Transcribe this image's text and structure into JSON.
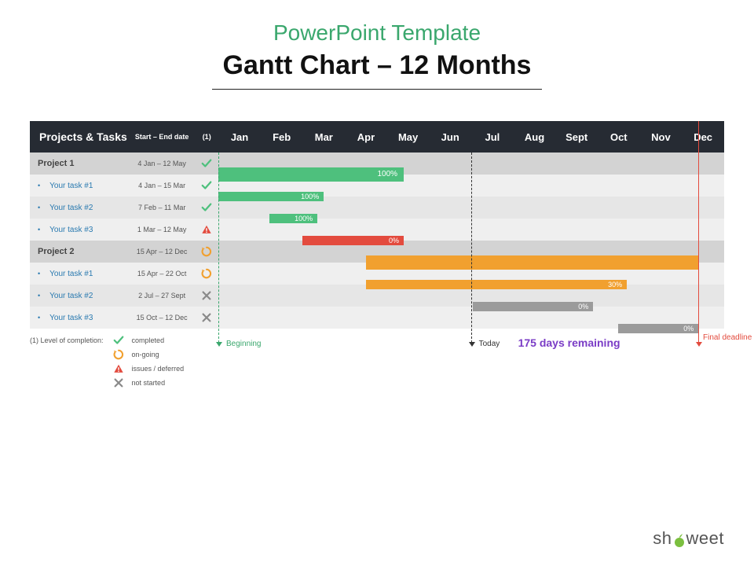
{
  "header": {
    "subtitle": "PowerPoint Template",
    "title": "Gantt Chart – 12 Months"
  },
  "columns": {
    "name": "Projects & Tasks",
    "dates": "Start – End date",
    "status": "(1)"
  },
  "months": [
    "Jan",
    "Feb",
    "Mar",
    "Apr",
    "May",
    "Jun",
    "Jul",
    "Aug",
    "Sept",
    "Oct",
    "Nov",
    "Dec"
  ],
  "rows": [
    {
      "kind": "proj",
      "name": "Project 1",
      "dates": "4 Jan – 12  May",
      "status": "check"
    },
    {
      "kind": "task",
      "name": "Your task #1",
      "dates": "4 Jan – 15 Mar",
      "status": "check"
    },
    {
      "kind": "task",
      "name": "Your task #2",
      "dates": "7 Feb – 11 Mar",
      "status": "check",
      "alt": true
    },
    {
      "kind": "task",
      "name": "Your task #3",
      "dates": "1 Mar – 12 May",
      "status": "warn"
    },
    {
      "kind": "proj",
      "name": "Project 2",
      "dates": "15 Apr – 12 Dec",
      "status": "cycle"
    },
    {
      "kind": "task",
      "name": "Your task #1",
      "dates": "15 Apr – 22 Oct",
      "status": "cycle"
    },
    {
      "kind": "task",
      "name": "Your task #2",
      "dates": "2 Jul – 27 Sept",
      "status": "cross",
      "alt": true
    },
    {
      "kind": "task",
      "name": "Your task #3",
      "dates": "15 Oct – 12 Dec",
      "status": "cross"
    }
  ],
  "status_labels": {
    "check": "completed",
    "cycle": "on-going",
    "warn": "issues / deferred",
    "cross": "not started"
  },
  "legend_head": "(1) Level of completion:",
  "markers": {
    "beginning_label": "Beginning",
    "today_label": "Today",
    "final_label": "Final deadline",
    "remaining": "175 days remaining"
  },
  "brand": {
    "pre": "sh",
    "post": "weet"
  },
  "chart_data": {
    "type": "gantt",
    "title": "Gantt Chart – 12 Months",
    "x_categories": [
      "Jan",
      "Feb",
      "Mar",
      "Apr",
      "May",
      "Jun",
      "Jul",
      "Aug",
      "Sept",
      "Oct",
      "Nov",
      "Dec"
    ],
    "markers": {
      "beginning_month_index": 0,
      "today_month_index": 6.0,
      "final_deadline_month_index": 11.4
    },
    "days_remaining": 175,
    "rows": [
      {
        "row": 0,
        "type": "project",
        "name": "Project 1",
        "start": "4 Jan",
        "end": "12 May",
        "start_idx": 0.0,
        "end_idx": 4.4,
        "completion_pct": 100,
        "status": "completed",
        "color": "green"
      },
      {
        "row": 1,
        "type": "task",
        "name": "Your task #1",
        "start": "4 Jan",
        "end": "15 Mar",
        "start_idx": 0.0,
        "end_idx": 2.5,
        "completion_pct": 100,
        "status": "completed",
        "color": "green"
      },
      {
        "row": 2,
        "type": "task",
        "name": "Your task #2",
        "start": "7 Feb",
        "end": "11 Mar",
        "start_idx": 1.2,
        "end_idx": 2.35,
        "completion_pct": 100,
        "status": "completed",
        "color": "green"
      },
      {
        "row": 3,
        "type": "task",
        "name": "Your task #3",
        "start": "1 Mar",
        "end": "12 May",
        "start_idx": 2.0,
        "end_idx": 4.4,
        "completion_pct": 0,
        "status": "issues/deferred",
        "color": "red"
      },
      {
        "row": 4,
        "type": "project",
        "name": "Project 2",
        "start": "15 Apr",
        "end": "12 Dec",
        "start_idx": 3.5,
        "end_idx": 11.4,
        "completion_pct": null,
        "status": "on-going",
        "color": "orange"
      },
      {
        "row": 5,
        "type": "task",
        "name": "Your task #1",
        "start": "15 Apr",
        "end": "22 Oct",
        "start_idx": 3.5,
        "end_idx": 9.7,
        "completion_pct": 30,
        "status": "on-going",
        "color": "orange"
      },
      {
        "row": 6,
        "type": "task",
        "name": "Your task #2",
        "start": "2 Jul",
        "end": "27 Sept",
        "start_idx": 6.05,
        "end_idx": 8.9,
        "completion_pct": 0,
        "status": "not started",
        "color": "gray"
      },
      {
        "row": 7,
        "type": "task",
        "name": "Your task #3",
        "start": "15 Oct",
        "end": "12 Dec",
        "start_idx": 9.5,
        "end_idx": 11.4,
        "completion_pct": 0,
        "status": "not started",
        "color": "gray"
      }
    ]
  }
}
